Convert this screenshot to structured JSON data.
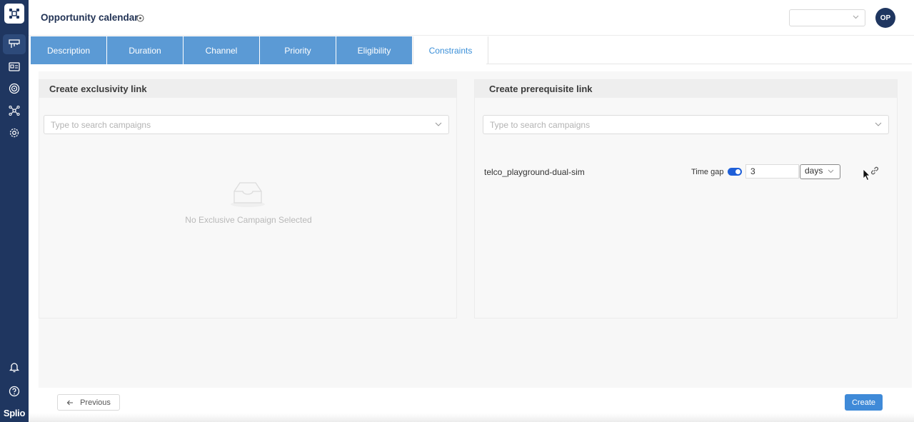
{
  "app": {
    "brand": "Splio"
  },
  "header": {
    "title": "Opportunity calendar",
    "select_value": "",
    "avatar_initials": "OP"
  },
  "tabs": [
    {
      "label": "Description"
    },
    {
      "label": "Duration"
    },
    {
      "label": "Channel"
    },
    {
      "label": "Priority"
    },
    {
      "label": "Eligibility"
    },
    {
      "label": "Constraints",
      "active": true
    }
  ],
  "exclusivity": {
    "title": "Create exclusivity link",
    "search_placeholder": "Type to search campaigns",
    "empty_text": "No Exclusive Campaign Selected"
  },
  "prerequisite": {
    "title": "Create prerequisite link",
    "search_placeholder": "Type to search campaigns",
    "campaign": {
      "name": "telco_playground-dual-sim",
      "time_gap_label": "Time gap",
      "time_gap_enabled": true,
      "time_gap_value": "3",
      "time_gap_unit": "days"
    }
  },
  "footer": {
    "previous_label": "Previous",
    "create_label": "Create"
  },
  "colors": {
    "sidebar": "#1f3660",
    "tab": "#5b9ad5",
    "accent": "#3f8ad8",
    "toggle": "#1e5fd8"
  }
}
